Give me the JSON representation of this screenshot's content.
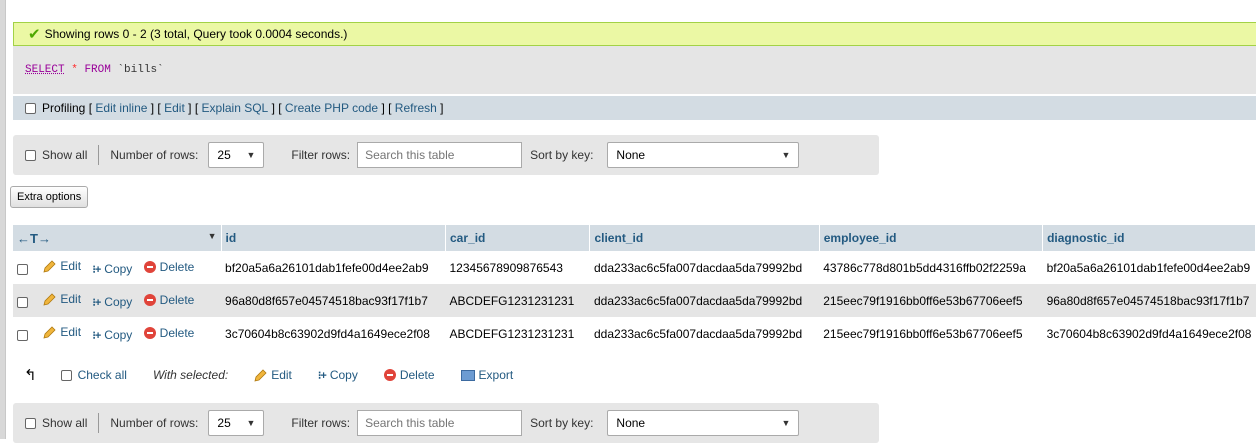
{
  "message": "Showing rows 0 - 2 (3 total, Query took 0.0004 seconds.)",
  "sql": {
    "select": "SELECT",
    "star": "*",
    "from": "FROM",
    "table": "`bills`"
  },
  "profiling": {
    "label": "Profiling",
    "links": [
      "Edit inline",
      "Edit",
      "Explain SQL",
      "Create PHP code",
      "Refresh"
    ]
  },
  "nav": {
    "show_all": "Show all",
    "rows_label": "Number of rows:",
    "rows_value": "25",
    "filter_label": "Filter rows:",
    "search_placeholder": "Search this table",
    "sort_label": "Sort by key:",
    "sort_value": "None"
  },
  "extra_options": "Extra options",
  "table": {
    "arrows": "←T→",
    "columns": [
      "id",
      "car_id",
      "client_id",
      "employee_id",
      "diagnostic_id"
    ],
    "actions": {
      "edit": "Edit",
      "copy": "Copy",
      "delete": "Delete"
    },
    "rows": [
      {
        "id": "bf20a5a6a26101dab1fefe00d4ee2ab9",
        "car_id": "12345678909876543",
        "client_id": "dda233ac6c5fa007dacdaa5da79992bd",
        "employee_id": "43786c778d801b5dd4316ffb02f2259a",
        "diagnostic_id": "bf20a5a6a26101dab1fefe00d4ee2ab9"
      },
      {
        "id": "96a80d8f657e04574518bac93f17f1b7",
        "car_id": "ABCDEFG1231231231",
        "client_id": "dda233ac6c5fa007dacdaa5da79992bd",
        "employee_id": "215eec79f1916bb0ff6e53b67706eef5",
        "diagnostic_id": "96a80d8f657e04574518bac93f17f1b7"
      },
      {
        "id": "3c70604b8c63902d9fd4a1649ece2f08",
        "car_id": "ABCDEFG1231231231",
        "client_id": "dda233ac6c5fa007dacdaa5da79992bd",
        "employee_id": "215eec79f1916bb0ff6e53b67706eef5",
        "diagnostic_id": "3c70604b8c63902d9fd4a1649ece2f08"
      }
    ]
  },
  "bulk": {
    "check_all": "Check all",
    "with_selected": "With selected:",
    "edit": "Edit",
    "copy": "Copy",
    "delete": "Delete",
    "export": "Export"
  },
  "colors": {
    "success_bg": "#ebf8a4",
    "header_bg": "#d3dce3",
    "link": "#235a81"
  }
}
